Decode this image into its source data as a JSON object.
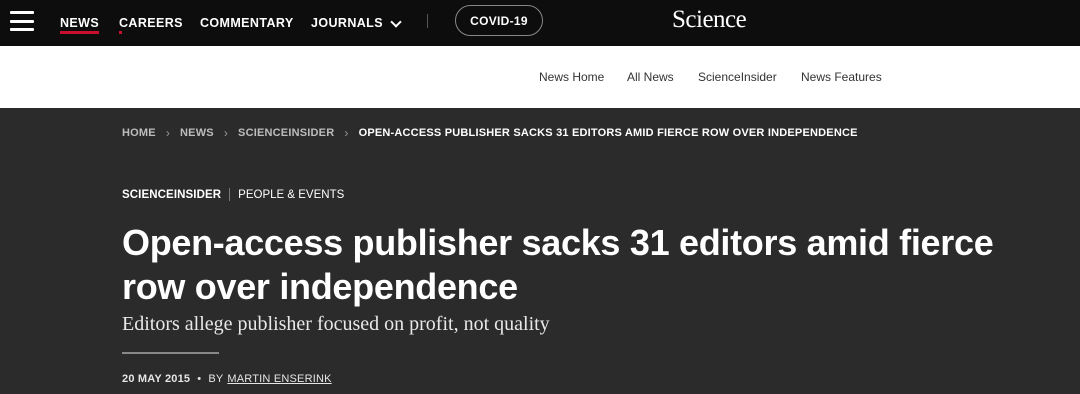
{
  "topnav": {
    "items": [
      "NEWS",
      "CAREERS",
      "COMMENTARY",
      "JOURNALS"
    ],
    "covid_label": "COVID-19",
    "brand": "Science",
    "accent_color": "#c8102e"
  },
  "subnav": {
    "items": [
      "News Home",
      "All News",
      "ScienceInsider",
      "News Features"
    ]
  },
  "breadcrumb": {
    "items": [
      "HOME",
      "NEWS",
      "SCIENCEINSIDER",
      "OPEN-ACCESS PUBLISHER SACKS 31 EDITORS AMID FIERCE ROW OVER INDEPENDENCE"
    ]
  },
  "article": {
    "section": "SCIENCEINSIDER",
    "category": "PEOPLE & EVENTS",
    "headline": "Open-access publisher sacks 31 editors amid fierce row over independence",
    "dek": "Editors allege publisher focused on profit, not quality",
    "date": "20 MAY 2015",
    "by": "BY",
    "author": "MARTIN ENSERINK"
  }
}
